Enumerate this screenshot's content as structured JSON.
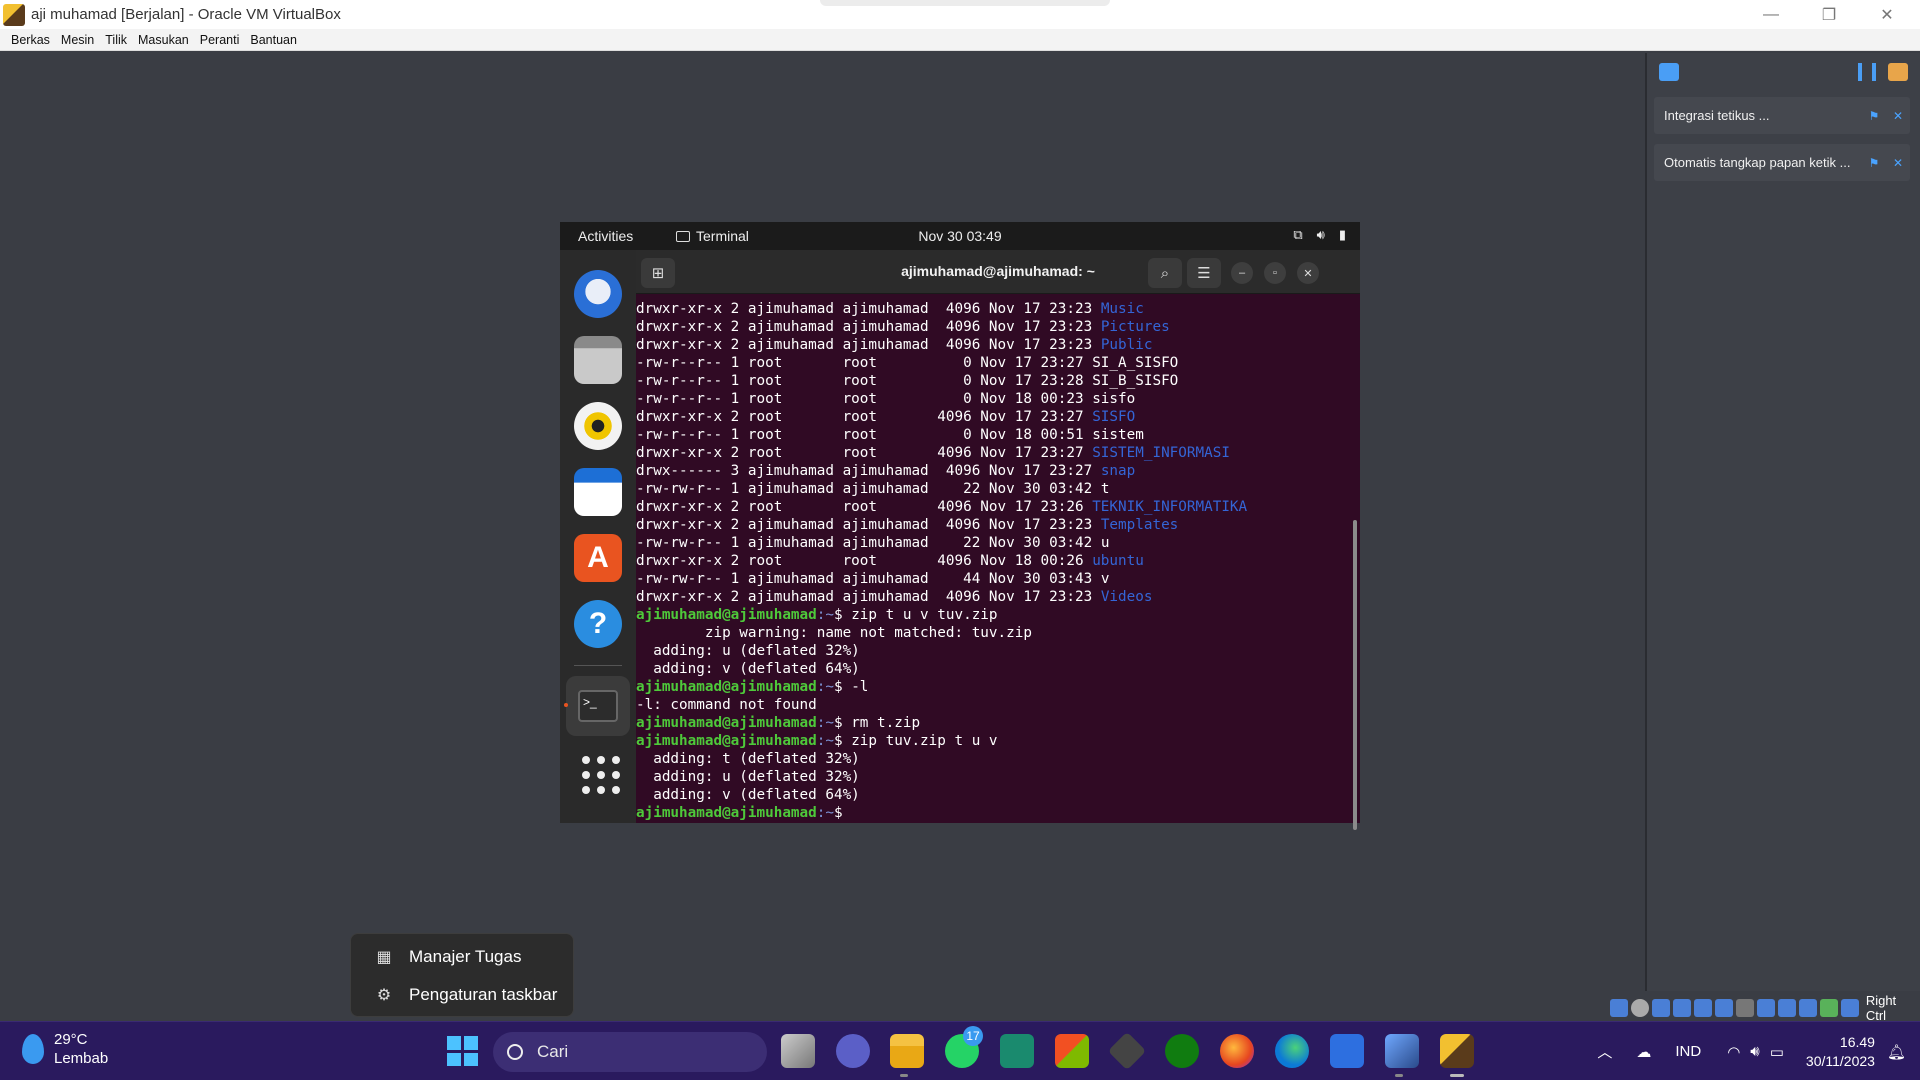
{
  "window": {
    "title": "aji muhamad  [Berjalan] - Oracle VM VirtualBox"
  },
  "menubar": {
    "items": [
      "Berkas",
      "Mesin",
      "Tilik",
      "Masukan",
      "Peranti",
      "Bantuan"
    ]
  },
  "vbox_side": {
    "notifications": [
      {
        "label": "Integrasi tetikus ..."
      },
      {
        "label": "Otomatis tangkap papan ketik ..."
      }
    ]
  },
  "guest": {
    "topbar": {
      "activities": "Activities",
      "app": "Terminal",
      "clock": "Nov 30  03:49"
    },
    "terminal": {
      "title": "ajimuhamad@ajimuhamad: ~",
      "lines": [
        {
          "pre": "drwxr-xr-x 2 ajimuhamad ajimuhamad  4096 Nov 17 23:23 ",
          "name": "Music",
          "kind": "dir"
        },
        {
          "pre": "drwxr-xr-x 2 ajimuhamad ajimuhamad  4096 Nov 17 23:23 ",
          "name": "Pictures",
          "kind": "dir"
        },
        {
          "pre": "drwxr-xr-x 2 ajimuhamad ajimuhamad  4096 Nov 17 23:23 ",
          "name": "Public",
          "kind": "dir"
        },
        {
          "pre": "-rw-r--r-- 1 root       root          0 Nov 17 23:27 ",
          "name": "SI_A_SISFO",
          "kind": "file"
        },
        {
          "pre": "-rw-r--r-- 1 root       root          0 Nov 17 23:28 ",
          "name": "SI_B_SISFO",
          "kind": "file"
        },
        {
          "pre": "-rw-r--r-- 1 root       root          0 Nov 18 00:23 ",
          "name": "sisfo",
          "kind": "file"
        },
        {
          "pre": "drwxr-xr-x 2 root       root       4096 Nov 17 23:27 ",
          "name": "SISFO",
          "kind": "dir"
        },
        {
          "pre": "-rw-r--r-- 1 root       root          0 Nov 18 00:51 ",
          "name": "sistem",
          "kind": "file"
        },
        {
          "pre": "drwxr-xr-x 2 root       root       4096 Nov 17 23:27 ",
          "name": "SISTEM_INFORMASI",
          "kind": "dir"
        },
        {
          "pre": "drwx------ 3 ajimuhamad ajimuhamad  4096 Nov 17 23:27 ",
          "name": "snap",
          "kind": "dir"
        },
        {
          "pre": "-rw-rw-r-- 1 ajimuhamad ajimuhamad    22 Nov 30 03:42 ",
          "name": "t",
          "kind": "file"
        },
        {
          "pre": "drwxr-xr-x 2 root       root       4096 Nov 17 23:26 ",
          "name": "TEKNIK_INFORMATIKA",
          "kind": "dir"
        },
        {
          "pre": "drwxr-xr-x 2 ajimuhamad ajimuhamad  4096 Nov 17 23:23 ",
          "name": "Templates",
          "kind": "dir"
        },
        {
          "pre": "-rw-rw-r-- 1 ajimuhamad ajimuhamad    22 Nov 30 03:42 ",
          "name": "u",
          "kind": "file"
        },
        {
          "pre": "drwxr-xr-x 2 root       root       4096 Nov 18 00:26 ",
          "name": "ubuntu",
          "kind": "dir"
        },
        {
          "pre": "-rw-rw-r-- 1 ajimuhamad ajimuhamad    44 Nov 30 03:43 ",
          "name": "v",
          "kind": "file"
        },
        {
          "pre": "drwxr-xr-x 2 ajimuhamad ajimuhamad  4096 Nov 17 23:23 ",
          "name": "Videos",
          "kind": "dir"
        },
        {
          "prompt": "ajimuhamad@ajimuhamad",
          "path": ":~",
          "cmd": "$ zip t u v tuv.zip",
          "kind": "prompt"
        },
        {
          "pre": "        zip warning: name not matched: tuv.zip",
          "kind": "out"
        },
        {
          "pre": "  adding: u (deflated 32%)",
          "kind": "out"
        },
        {
          "pre": "  adding: v (deflated 64%)",
          "kind": "out"
        },
        {
          "prompt": "ajimuhamad@ajimuhamad",
          "path": ":~",
          "cmd": "$ -l",
          "kind": "prompt"
        },
        {
          "pre": "-l: command not found",
          "kind": "out"
        },
        {
          "prompt": "ajimuhamad@ajimuhamad",
          "path": ":~",
          "cmd": "$ rm t.zip",
          "kind": "prompt"
        },
        {
          "prompt": "ajimuhamad@ajimuhamad",
          "path": ":~",
          "cmd": "$ zip tuv.zip t u v",
          "kind": "prompt"
        },
        {
          "pre": "  adding: t (deflated 32%)",
          "kind": "out"
        },
        {
          "pre": "  adding: u (deflated 32%)",
          "kind": "out"
        },
        {
          "pre": "  adding: v (deflated 64%)",
          "kind": "out"
        },
        {
          "prompt": "ajimuhamad@ajimuhamad",
          "path": ":~",
          "cmd": "$ ",
          "kind": "prompt"
        }
      ]
    }
  },
  "context_menu": {
    "task_manager": "Manajer Tugas",
    "taskbar_settings": "Pengaturan taskbar"
  },
  "vbox_status": {
    "host_key": "Right Ctrl"
  },
  "taskbar": {
    "weather": {
      "temp": "29°C",
      "cond": "Lembab"
    },
    "search_placeholder": "Cari",
    "whatsapp_badge": "17",
    "lang": "IND",
    "time": "16.49",
    "date": "30/11/2023"
  },
  "colors": {
    "terminal_bg": "#300a24",
    "dir": "#3465d6",
    "prompt": "#4ec93a",
    "taskbar": "#2a1a5e"
  }
}
